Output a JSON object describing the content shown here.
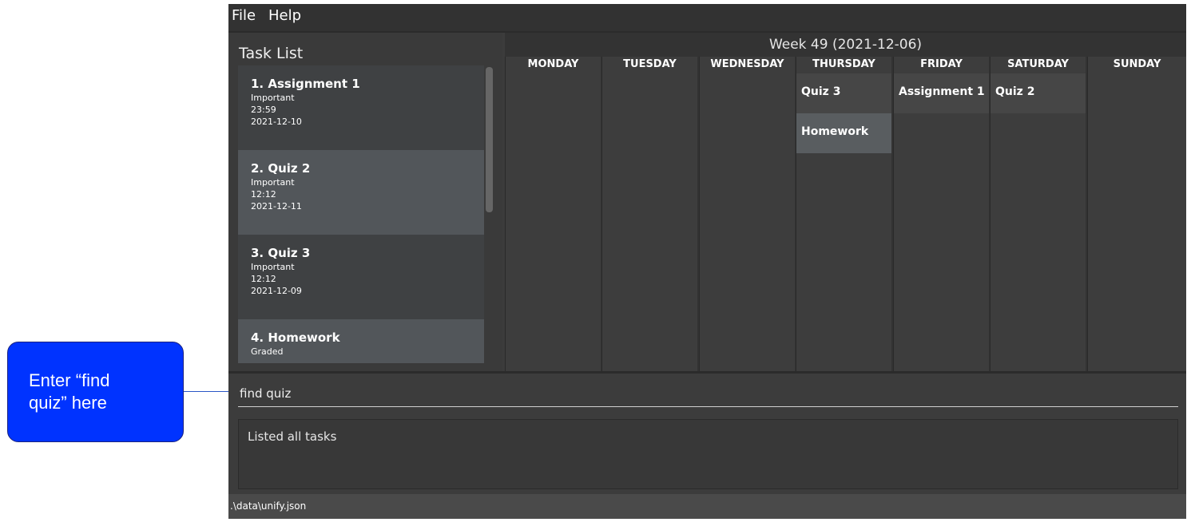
{
  "callout": {
    "line1": "Enter “find",
    "line2": "quiz” here"
  },
  "menu": {
    "file": "File",
    "help": "Help"
  },
  "task_list": {
    "title": "Task List",
    "tasks": [
      {
        "title": "1.  Assignment 1",
        "tag": "Important",
        "time": "23:59",
        "date": "2021-12-10"
      },
      {
        "title": "2.  Quiz 2",
        "tag": "Important",
        "time": "12:12",
        "date": "2021-12-11"
      },
      {
        "title": "3.  Quiz 3",
        "tag": "Important",
        "time": "12:12",
        "date": "2021-12-09"
      },
      {
        "title": "4.  Homework",
        "tag": "Graded"
      }
    ]
  },
  "calendar": {
    "week_title": "Week 49 (2021-12-06)",
    "days": [
      "MONDAY",
      "TUESDAY",
      "WEDNESDAY",
      "THURSDAY",
      "FRIDAY",
      "SATURDAY",
      "SUNDAY"
    ],
    "events": {
      "thursday": [
        "Quiz 3",
        "Homework"
      ],
      "friday": [
        "Assignment 1"
      ],
      "saturday": [
        "Quiz 2"
      ]
    }
  },
  "command_box": {
    "value": "find quiz"
  },
  "result_display": {
    "text": "Listed all tasks"
  },
  "status_bar": {
    "path": ".\\data\\unify.json"
  }
}
